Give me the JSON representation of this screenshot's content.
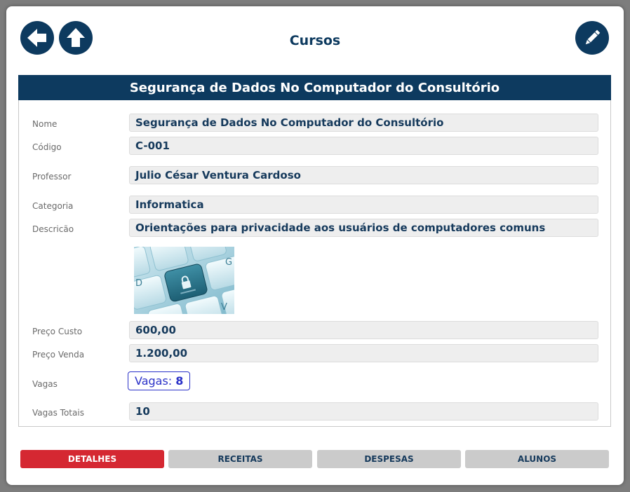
{
  "header": {
    "title": "Cursos"
  },
  "course": {
    "heading": "Segurança de Dados No Computador do Consultório",
    "fields": [
      {
        "label": "Nome",
        "value": "Segurança de Dados No Computador do Consultório"
      },
      {
        "label": "Código",
        "value": "C-001"
      },
      {
        "label": "Professor",
        "value": "Julio César Ventura Cardoso"
      },
      {
        "label": "Categoria",
        "value": "Informatica"
      },
      {
        "label": "Descricão",
        "value": "Orientações para privacidade aos usuários de computadores comuns"
      },
      {
        "label": "Preço Custo",
        "value": "600,00"
      },
      {
        "label": "Preço Venda",
        "value": "1.200,00"
      },
      {
        "label": "Vagas",
        "value": ""
      },
      {
        "label": "Vagas Totais",
        "value": "10"
      }
    ],
    "vagas_badge": {
      "label": "Vagas:",
      "count": "8"
    }
  },
  "tabs": [
    {
      "label": "DETALHES",
      "active": true
    },
    {
      "label": "RECEITAS",
      "active": false
    },
    {
      "label": "DESPESAS",
      "active": false
    },
    {
      "label": "ALUNOS",
      "active": false
    }
  ],
  "colors": {
    "primary": "#0d3a5f",
    "active_tab": "#d52832",
    "inactive_tab": "#cbcbcb",
    "badge": "#2a31c8"
  },
  "icons": {
    "back": "arrow-left-icon",
    "home": "arrow-up-icon",
    "edit": "pencil-icon"
  }
}
